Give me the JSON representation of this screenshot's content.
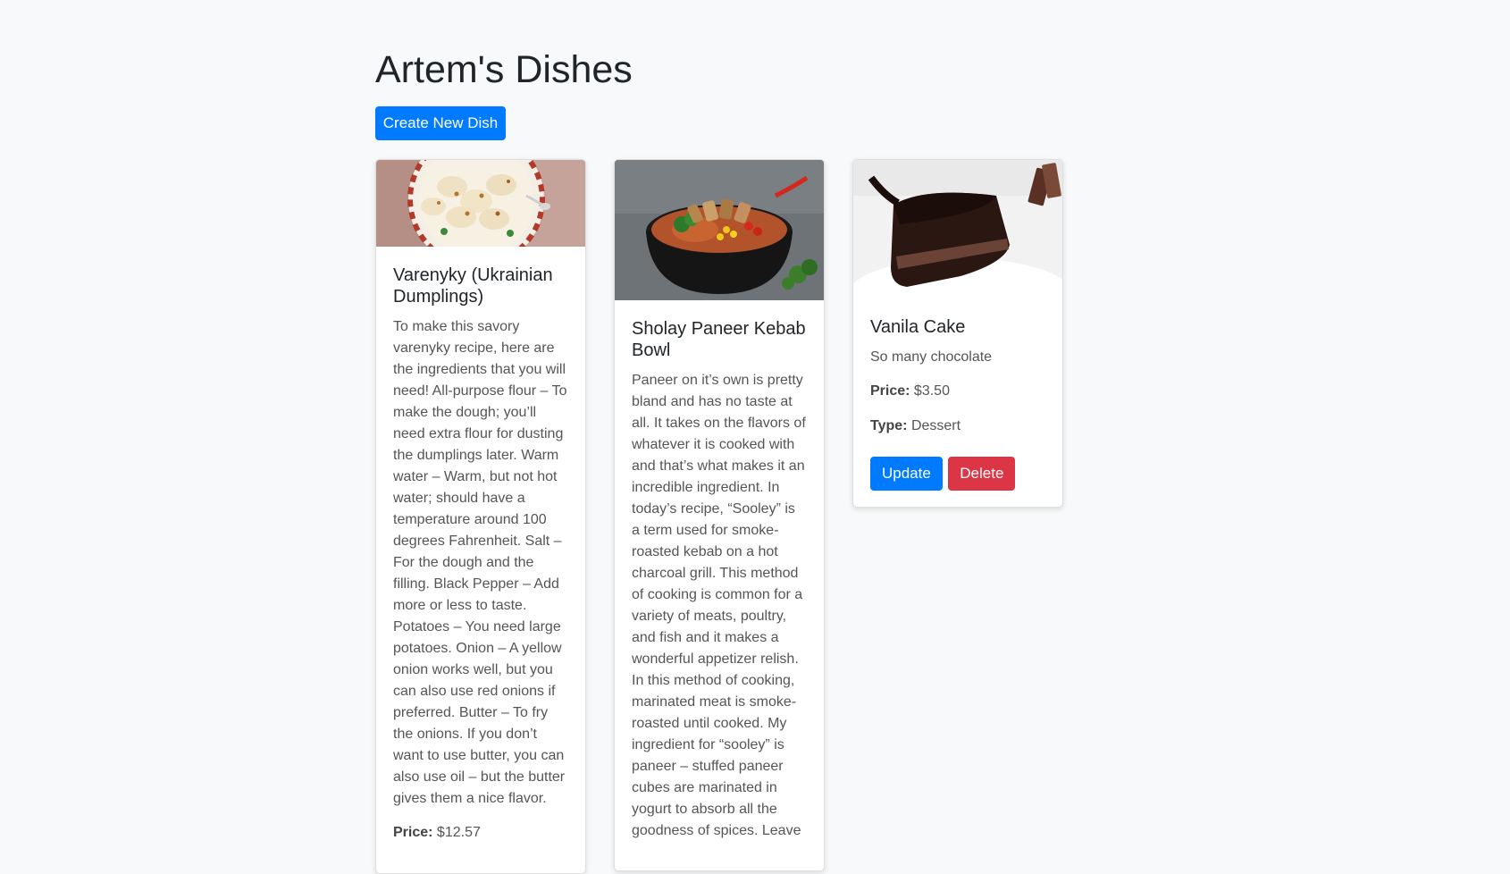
{
  "page": {
    "title": "Artem's Dishes"
  },
  "toolbar": {
    "create_label": "Create New Dish"
  },
  "labels": {
    "price": "Price:",
    "type": "Type:"
  },
  "dishes": [
    {
      "title": "Varenyky (Ukrainian Dumplings)",
      "description": "To make this savory varenyky recipe, here are the ingredients that you will need! All-purpose flour – To make the dough; you’ll need extra flour for dusting the dumplings later. Warm water – Warm, but not hot water; should have a temperature around 100 degrees Fahrenheit. Salt – For the dough and the filling. Black Pepper – Add more or less to taste. Potatoes – You need large potatoes. Onion – A yellow onion works well, but you can also use red onions if preferred. Butter – To fry the onions. If you don’t want to use butter, you can also use oil – but the butter gives them a nice flavor.",
      "price": "$12.57"
    },
    {
      "title": "Sholay Paneer Kebab Bowl",
      "description": "Paneer on it’s own is pretty bland and has no taste at all. It takes on the flavors of whatever it is cooked with and that’s what makes it an incredible ingredient. In today’s recipe, “Sooley” is a term used for smoke-roasted kebab on a hot charcoal grill. This method of cooking is common for a variety of meats, poultry, and fish and it makes a wonderful appetizer relish. In this method of cooking, marinated meat is smoke-roasted until cooked. My ingredient for “sooley” is paneer – stuffed paneer cubes are marinated in yogurt to absorb all the goodness of spices. Leave"
    },
    {
      "title": "Vanila Cake",
      "description": "So many chocolate",
      "price": "$3.50",
      "type": "Dessert",
      "update_label": "Update",
      "delete_label": "Delete"
    }
  ],
  "colors": {
    "primary": "#007bff",
    "danger": "#dc3545",
    "background": "#f8f9fa"
  }
}
